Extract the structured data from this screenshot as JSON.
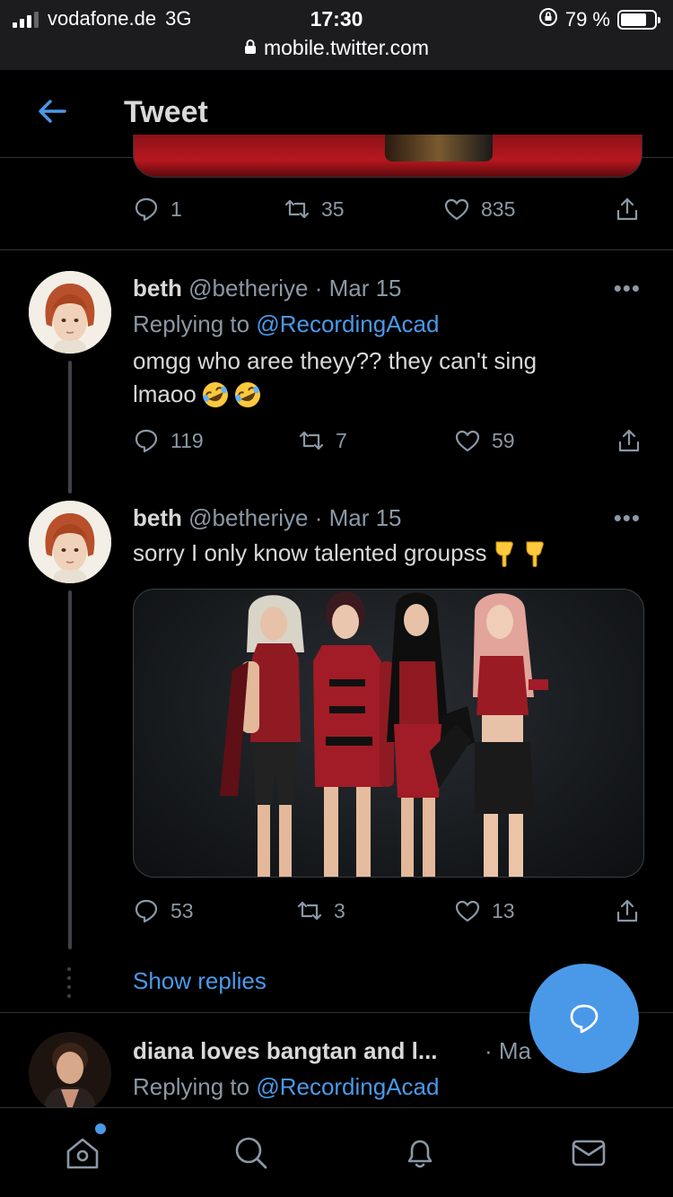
{
  "status_bar": {
    "carrier": "vodafone.de",
    "network": "3G",
    "time": "17:30",
    "battery": "79 %",
    "battery_level": 0.79,
    "url": "mobile.twitter.com"
  },
  "header": {
    "title": "Tweet"
  },
  "prev_tweet": {
    "replies": "1",
    "retweets": "35",
    "likes": "835"
  },
  "tweets": [
    {
      "name": "beth",
      "handle": "@betheriye",
      "date": "· Mar 15",
      "replying_label": "Replying to",
      "replying_handle": "@RecordingAcad",
      "text_line1": "omgg who aree theyy?? they can't sing",
      "text_line2": "lmaoo",
      "emojis": "🤣🤣",
      "replies": "119",
      "retweets": "7",
      "likes": "59"
    },
    {
      "name": "beth",
      "handle": "@betheriye",
      "date": "· Mar 15",
      "text": "sorry I only know talented groupss",
      "emojis": "👇👇",
      "replies": "53",
      "retweets": "3",
      "likes": "13"
    }
  ],
  "show_replies": "Show replies",
  "next_tweet": {
    "name": "diana loves bangtan and l...",
    "date": "· Ma",
    "replying_label": "Replying to",
    "replying_handle": "@RecordingAcad"
  },
  "more_label": "•••",
  "colors": {
    "accent": "#4a99e9",
    "background": "#000000",
    "muted": "#8b98a5",
    "text": "#d9d9d9"
  }
}
